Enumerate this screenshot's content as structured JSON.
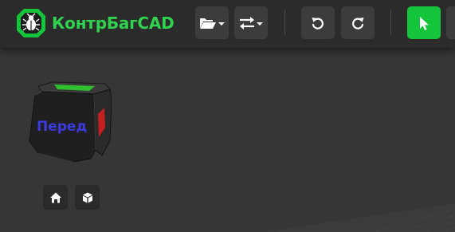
{
  "app": {
    "name": "КонтрБагCAD",
    "logo_icon": "bug-logo-icon",
    "brand_color": "#2fd14e",
    "accent_color": "#14c53c",
    "background_color": "#363636",
    "toolbar_color": "#2b2b2b"
  },
  "toolbar": {
    "buttons": [
      {
        "id": "file-menu",
        "icon": "folder-open-icon",
        "dropdown": true
      },
      {
        "id": "transform-menu",
        "icon": "swap-arrows-icon",
        "dropdown": true
      },
      {
        "id": "undo",
        "icon": "undo-icon"
      },
      {
        "id": "redo",
        "icon": "redo-icon"
      },
      {
        "id": "select",
        "icon": "pointer-cursor-icon",
        "active": true
      }
    ]
  },
  "view_cube": {
    "front_label": "Перед",
    "front_label_color": "#3a3ae0",
    "top_edge_color": "#2fbf2f",
    "right_edge_color": "#d02020"
  },
  "view_controls": [
    {
      "id": "home-view",
      "icon": "home-icon"
    },
    {
      "id": "iso-view",
      "icon": "cube-icon"
    }
  ]
}
